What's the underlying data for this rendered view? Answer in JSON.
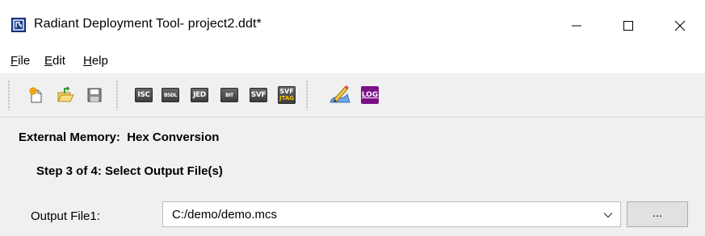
{
  "window": {
    "title": "Radiant Deployment Tool- project2.ddt*",
    "app_icon": "radiant-app-icon",
    "controls": [
      "minimize-icon",
      "maximize-icon",
      "close-icon"
    ]
  },
  "menu": {
    "items": [
      {
        "label": "File",
        "mnemonic": "F",
        "rest": "ile"
      },
      {
        "label": "Edit",
        "mnemonic": "E",
        "rest": "dit"
      },
      {
        "label": "Help",
        "mnemonic": "H",
        "rest": "elp"
      }
    ]
  },
  "toolbar": {
    "buttons": [
      {
        "icon": "new-file-icon"
      },
      {
        "icon": "open-folder-icon"
      },
      {
        "icon": "save-icon"
      },
      {
        "icon": "isc-format-icon",
        "label": "ISC"
      },
      {
        "icon": "bsdl-format-icon",
        "label": "BSDL"
      },
      {
        "icon": "jed-format-icon",
        "label": "JED"
      },
      {
        "icon": "bitstream-format-icon",
        "label": "BIT"
      },
      {
        "icon": "svf-format-icon",
        "label": "SVF"
      },
      {
        "icon": "svf-jtag-format-icon",
        "label_top": "SVF",
        "label_bottom": "JTAG"
      },
      {
        "icon": "deploy-edit-icon"
      },
      {
        "icon": "log-icon",
        "label": "LOG"
      }
    ]
  },
  "content": {
    "section_title": "External Memory:  Hex Conversion",
    "step_title": "Step 3 of 4: Select Output File(s)",
    "output_file_label": "Output File1:",
    "output_file_value": "C:/demo/demo.mcs",
    "browse_label": "..."
  }
}
